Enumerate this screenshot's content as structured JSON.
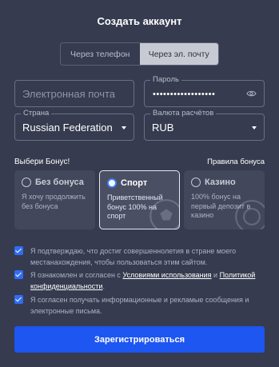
{
  "title": "Создать аккаунт",
  "tabs": [
    {
      "label": "Через телефон",
      "active": false
    },
    {
      "label": "Через эл. почту",
      "active": true
    }
  ],
  "email": {
    "placeholder": "Электронная почта",
    "value": ""
  },
  "password": {
    "label": "Пароль",
    "masked_value": "••••••••••••••••••"
  },
  "country": {
    "label": "Страна",
    "value": "Russian Federation"
  },
  "currency": {
    "label": "Валюта расчётов",
    "value": "RUB"
  },
  "bonus": {
    "heading": "Выбери Бонус!",
    "rules_link": "Правила бонуса",
    "options": [
      {
        "name": "Без бонуса",
        "desc": "Я хочу продолжить без бонуса",
        "selected": false
      },
      {
        "name": "Спорт",
        "desc": "Приветственный бонус 100% на спорт",
        "selected": true
      },
      {
        "name": "Казино",
        "desc": "100% бонус на первый депозит в казино",
        "selected": false
      }
    ]
  },
  "consents": {
    "age": "Я подтверждаю, что достиг совершеннолетия в стране моего местанахождения, чтобы пользоваться этим сайтом.",
    "terms_prefix": "Я ознакомлен и согласен с ",
    "terms_link": "Условиями использования",
    "terms_and": " и ",
    "privacy_link": "Политикой конфиденциальности",
    "terms_suffix": ".",
    "marketing": "Я согласен получать информационные и рекламые сообщения и электронные письма."
  },
  "submit_label": "Зарегистрироваться",
  "colors": {
    "accent": "#1d56f0",
    "background": "#363b4f",
    "checkbox": "#2f6df5"
  }
}
